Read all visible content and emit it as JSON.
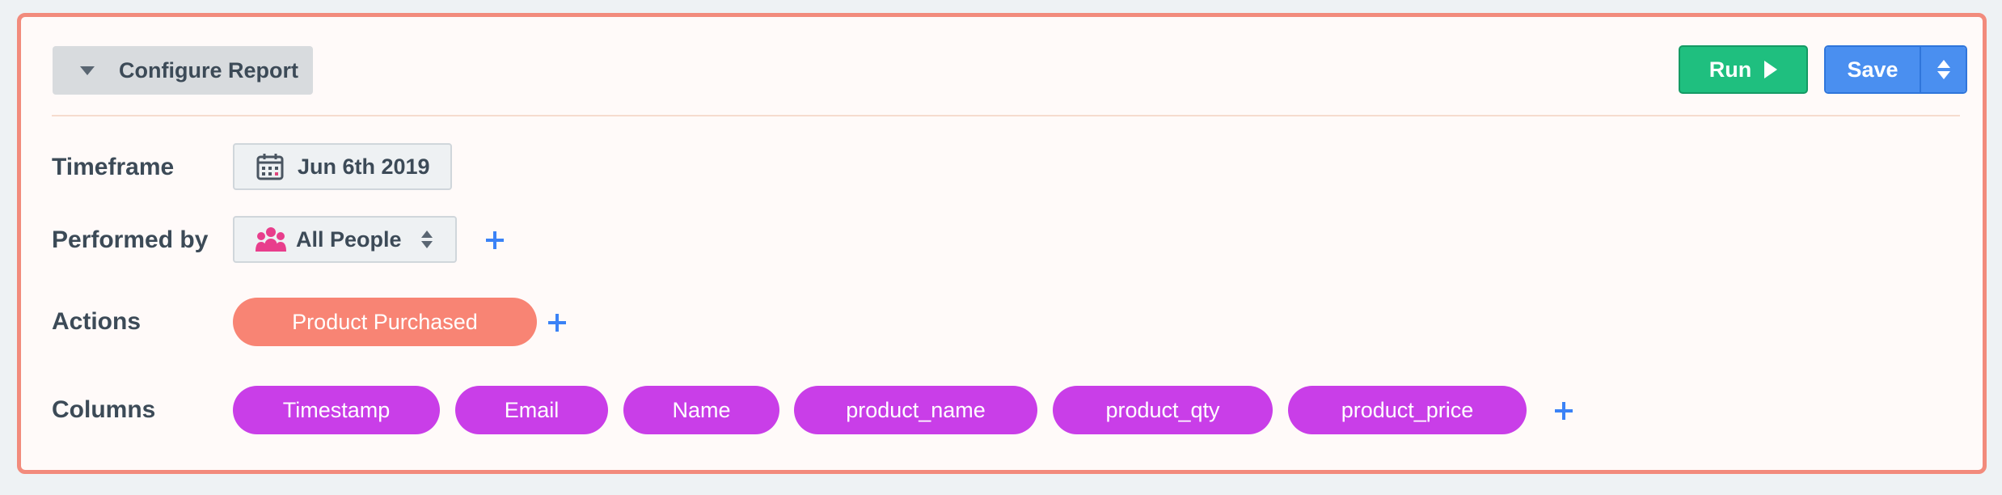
{
  "header": {
    "configure_label": "Configure Report",
    "run_label": "Run",
    "save_label": "Save"
  },
  "rows": {
    "timeframe": {
      "label": "Timeframe",
      "value": "Jun 6th 2019"
    },
    "performed_by": {
      "label": "Performed by",
      "value": "All People"
    },
    "actions": {
      "label": "Actions",
      "items": [
        "Product Purchased"
      ]
    },
    "columns": {
      "label": "Columns",
      "items": [
        "Timestamp",
        "Email",
        "Name",
        "product_name",
        "product_qty",
        "product_price"
      ]
    }
  },
  "colors": {
    "panel_border": "#f28b7c",
    "run_green": "#1fbf7f",
    "save_blue": "#4a8ff0",
    "action_pill": "#f88474",
    "column_pill": "#c93ee8",
    "add_blue": "#3b82f6"
  },
  "icons": {
    "toggle": "caret-down-icon",
    "run": "play-icon",
    "save_menu": "sort-arrows-icon",
    "timeframe": "calendar-icon",
    "people": "people-icon",
    "add": "plus-icon"
  }
}
